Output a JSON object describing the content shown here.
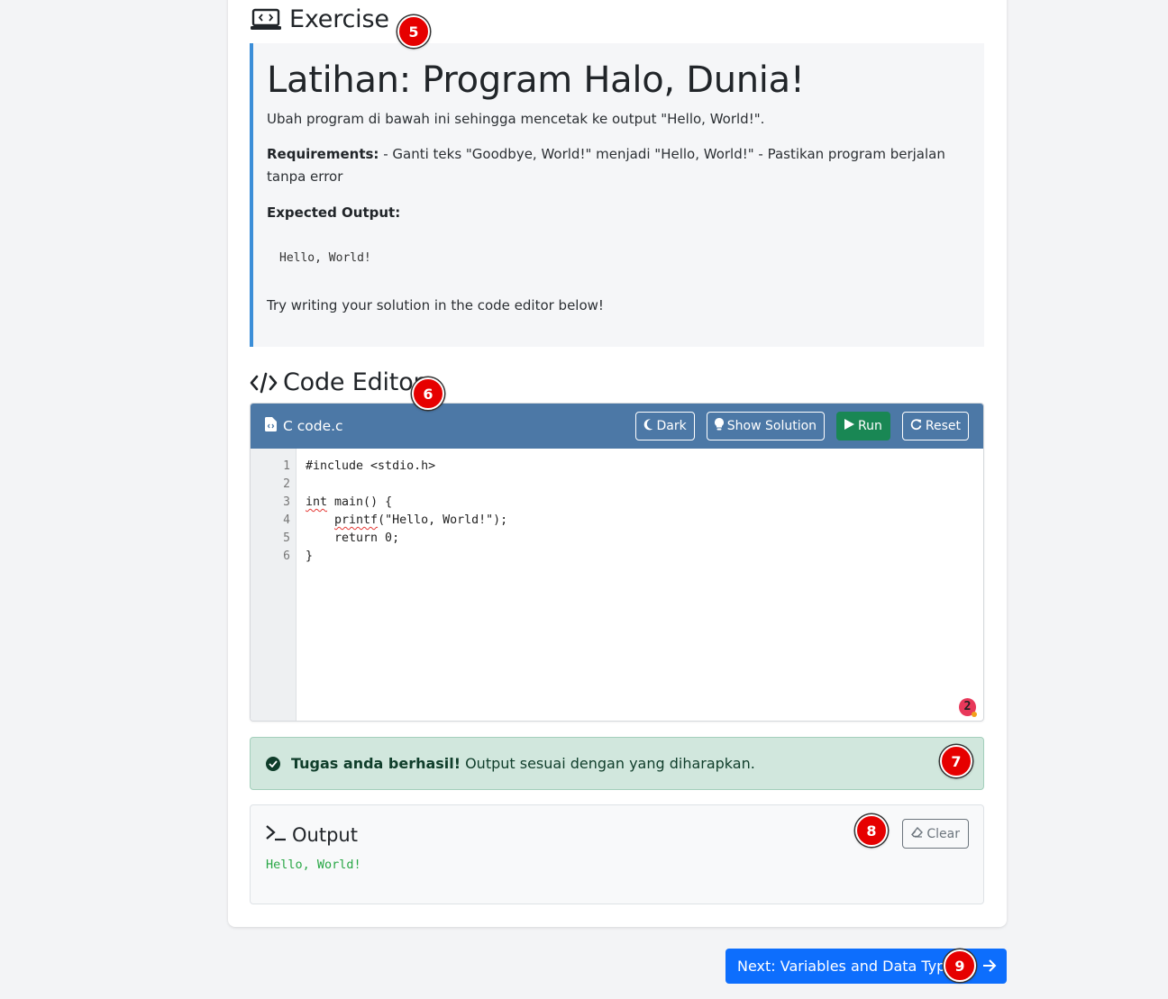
{
  "exercise": {
    "heading": "Exercise",
    "title": "Latihan: Program Halo, Dunia!",
    "description": "Ubah program di bawah ini sehingga mencetak ke output \"Hello, World!\".",
    "requirements_label": "Requirements:",
    "requirements_text": " - Ganti teks \"Goodbye, World!\" menjadi \"Hello, World!\" - Pastikan program berjalan tanpa error",
    "expected_label": "Expected Output:",
    "expected_output": "Hello, World!",
    "hint": "Try writing your solution in the code editor below!"
  },
  "code_editor": {
    "heading": "Code Editor",
    "file_label": "C code.c",
    "buttons": {
      "dark": "Dark",
      "show_solution": "Show Solution",
      "run": "Run",
      "reset": "Reset"
    },
    "line_numbers": [
      "1",
      "2",
      "3",
      "4",
      "5",
      "6"
    ],
    "code_lines": {
      "l1": "#include <stdio.h>",
      "l2": "",
      "l3_kw": "int",
      "l3_rest": " main() {",
      "l4_indent": "    ",
      "l4_fn": "printf",
      "l4_rest": "(\"Hello, World!\");",
      "l5": "    return 0;",
      "l6": "}"
    },
    "problem_count": "2"
  },
  "alert": {
    "bold": "Tugas anda berhasil!",
    "text": "Output sesuai dengan yang diharapkan."
  },
  "output": {
    "heading": "Output",
    "clear_label": "Clear",
    "text": "Hello, World!"
  },
  "next_button": {
    "label": "Next: Variables and Data Types"
  },
  "badges": {
    "b5": "5",
    "b6": "6",
    "b7": "7",
    "b8": "8",
    "b9": "9"
  },
  "colors": {
    "editor_bar": "#4c78a6",
    "run_button": "#198754",
    "alert_bg": "#d1e7dd",
    "next_button": "#0d6efd",
    "badge": "#e60000",
    "exercise_accent": "#3b8ed8",
    "output_text": "#28a745"
  }
}
